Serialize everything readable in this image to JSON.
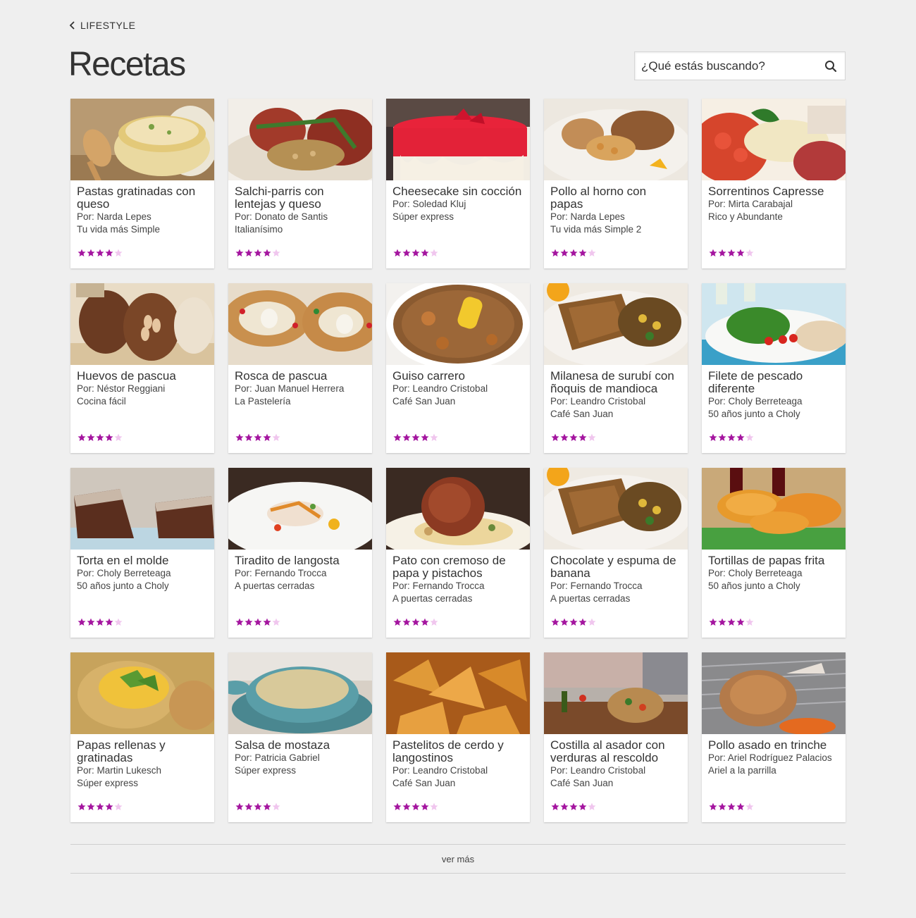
{
  "breadcrumb": {
    "label": "LIFESTYLE"
  },
  "page": {
    "title": "Recetas"
  },
  "search": {
    "placeholder": "¿Qué estás buscando?",
    "value": ""
  },
  "colors": {
    "star_on": "#a4159f",
    "star_off": "#f0c6ee",
    "background": "#efefef"
  },
  "recipes": [
    {
      "title": "Pastas gratinadas con queso",
      "author": "Por: Narda Lepes",
      "show": "Tu vida más Simple",
      "rating": 4,
      "image": "gratin-dish"
    },
    {
      "title": "Salchi-parris con lentejas y queso",
      "author": "Por: Donato de Santis",
      "show": "Italianísimo",
      "rating": 4,
      "image": "sausage-lentils"
    },
    {
      "title": "Cheesecake sin cocción",
      "author": "Por: Soledad Kluj",
      "show": "Súper express",
      "rating": 4,
      "image": "cheesecake"
    },
    {
      "title": "Pollo al horno con papas",
      "author": "Por: Narda Lepes",
      "show": "Tu vida más Simple 2",
      "rating": 4,
      "image": "roast-chicken"
    },
    {
      "title": "Sorrentinos Capresse",
      "author": "Por: Mirta Carabajal",
      "show": "Rico y Abundante",
      "rating": 4,
      "image": "sorrentinos"
    },
    {
      "title": "Huevos de pascua",
      "author": "Por: Néstor Reggiani",
      "show": "Cocina fácil",
      "rating": 4,
      "image": "easter-eggs"
    },
    {
      "title": "Rosca de pascua",
      "author": "Por:  Juan Manuel Herrera",
      "show": "La Pastelería",
      "rating": 4,
      "image": "rosca"
    },
    {
      "title": "Guiso carrero",
      "author": "Por: Leandro Cristobal",
      "show": "Café San Juan",
      "rating": 4,
      "image": "stew"
    },
    {
      "title": "Milanesa de surubí con ñoquis de mandioca",
      "author": "Por: Leandro Cristobal",
      "show": "Café San Juan",
      "rating": 4,
      "image": "milanesa"
    },
    {
      "title": "Filete de pescado diferente",
      "author": "Por: Choly Berreteaga",
      "show": "50 años junto a Choly",
      "rating": 4,
      "image": "fish-fillet"
    },
    {
      "title": "Torta en el molde",
      "author": "Por: Choly Berreteaga",
      "show": "50 años junto a Choly",
      "rating": 4,
      "image": "cake"
    },
    {
      "title": "Tiradito de langosta",
      "author": "Por:  Fernando Trocca",
      "show": "A puertas cerradas",
      "rating": 4,
      "image": "tiradito"
    },
    {
      "title": "Pato con cremoso de papa y pistachos",
      "author": "Por: Fernando Trocca",
      "show": "A puertas cerradas",
      "rating": 4,
      "image": "duck"
    },
    {
      "title": "Chocolate y espuma de banana",
      "author": "Por: Fernando Trocca",
      "show": "A puertas cerradas",
      "rating": 4,
      "image": "milanesa"
    },
    {
      "title": "Tortillas de papas frita",
      "author": "Por: Choly Berreteaga",
      "show": "50 años junto a Choly",
      "rating": 4,
      "image": "tortillas"
    },
    {
      "title": "Papas rellenas y gratinadas",
      "author": "Por: Martin Lukesch",
      "show": "Súper express",
      "rating": 4,
      "image": "stuffed-potatoes"
    },
    {
      "title": "Salsa de mostaza",
      "author": "Por:  Patricia Gabriel",
      "show": "Súper express",
      "rating": 4,
      "image": "mustard-sauce"
    },
    {
      "title": "Pastelitos de cerdo y langostinos",
      "author": "Por: Leandro Cristobal",
      "show": "Café San Juan",
      "rating": 4,
      "image": "pastelitos"
    },
    {
      "title": "Costilla al asador con verduras al rescoldo",
      "author": "Por: Leandro Cristobal",
      "show": "Café San Juan",
      "rating": 4,
      "image": "costilla"
    },
    {
      "title": "Pollo asado en trinche",
      "author": "Por: Ariel Rodríguez Palacios",
      "show": "Ariel a la parrilla",
      "rating": 4,
      "image": "grilled-chicken"
    }
  ],
  "rating_max": 5,
  "load_more": {
    "label": "ver más"
  }
}
